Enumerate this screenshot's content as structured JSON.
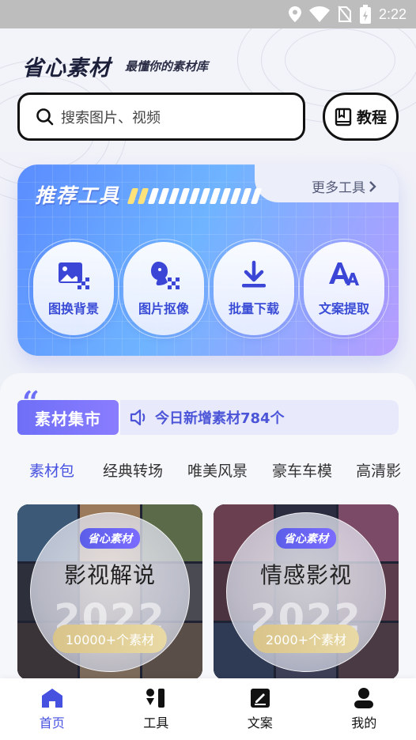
{
  "status_bar": {
    "time": "2:22"
  },
  "header": {
    "brand_logo": "省心素材",
    "slogan": "最懂你的素材库"
  },
  "search": {
    "placeholder": "搜索图片、视频"
  },
  "tutorial_button": {
    "label": "教程"
  },
  "tools": {
    "title": "推荐工具",
    "more_label": "更多工具",
    "items": [
      {
        "label": "图换背景",
        "icon": "image-replace-icon"
      },
      {
        "label": "图片抠像",
        "icon": "portrait-cutout-icon"
      },
      {
        "label": "批量下载",
        "icon": "download-icon"
      },
      {
        "label": "文案提取",
        "icon": "text-extract-icon"
      }
    ]
  },
  "market": {
    "title": "素材集市",
    "notice": "今日新增素材784个",
    "tabs": [
      "素材包",
      "经典转场",
      "唯美风景",
      "豪车车模",
      "高清影"
    ],
    "active_tab": 0,
    "packs": [
      {
        "badge": "省心素材",
        "title": "影视解说",
        "year": "2022",
        "count": "10000+个素材"
      },
      {
        "badge": "省心素材",
        "title": "情感影视",
        "year": "2022",
        "count": "2000+个素材"
      }
    ]
  },
  "bottom_nav": {
    "items": [
      {
        "label": "首页",
        "icon": "home-icon"
      },
      {
        "label": "工具",
        "icon": "tools-icon"
      },
      {
        "label": "文案",
        "icon": "note-edit-icon"
      },
      {
        "label": "我的",
        "icon": "user-icon"
      }
    ],
    "active": 0
  },
  "colors": {
    "accent": "#4751e0",
    "tag_purple": "#6e6ff7",
    "notice_bg": "#e8eafc"
  }
}
